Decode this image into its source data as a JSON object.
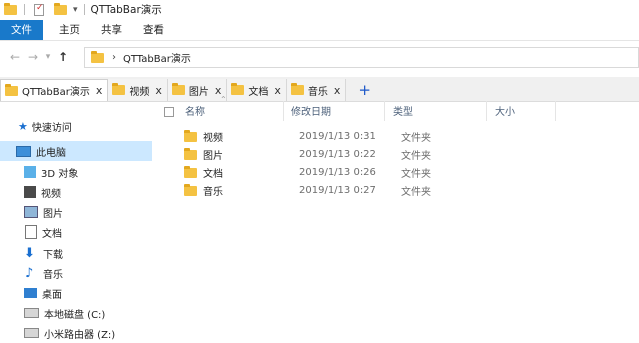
{
  "titlebar": {
    "title": "QTTabBar演示"
  },
  "ribbon": {
    "tabs": [
      "文件",
      "主页",
      "共享",
      "查看"
    ]
  },
  "address": {
    "chevron": "›",
    "path": "QTTabBar演示"
  },
  "folder_tabs": [
    {
      "label": "QTTabBar演示",
      "active": true
    },
    {
      "label": "视频",
      "active": false
    },
    {
      "label": "图片",
      "active": false
    },
    {
      "label": "文档",
      "active": false
    },
    {
      "label": "音乐",
      "active": false
    }
  ],
  "tab_close_glyph": "x",
  "new_tab_glyph": "+",
  "nav": {
    "quick_access": "快速访问",
    "items": [
      {
        "label": "此电脑",
        "icon": "computer-icon",
        "selected": true
      },
      {
        "label": "3D 对象",
        "icon": "3d-objects-icon"
      },
      {
        "label": "视频",
        "icon": "video-icon"
      },
      {
        "label": "图片",
        "icon": "pictures-icon"
      },
      {
        "label": "文档",
        "icon": "documents-icon"
      },
      {
        "label": "下载",
        "icon": "download-icon"
      },
      {
        "label": "音乐",
        "icon": "music-icon"
      },
      {
        "label": "桌面",
        "icon": "desktop-icon"
      },
      {
        "label": "本地磁盘 (C:)",
        "icon": "drive-icon"
      },
      {
        "label": "小米路由器 (Z:)",
        "icon": "network-drive-icon"
      }
    ]
  },
  "columns": {
    "name": "名称",
    "date": "修改日期",
    "type": "类型",
    "size": "大小"
  },
  "files": [
    {
      "name": "视频",
      "date": "2019/1/13 0:31",
      "type": "文件夹"
    },
    {
      "name": "图片",
      "date": "2019/1/13 0:22",
      "type": "文件夹"
    },
    {
      "name": "文档",
      "date": "2019/1/13 0:26",
      "type": "文件夹"
    },
    {
      "name": "音乐",
      "date": "2019/1/13 0:27",
      "type": "文件夹"
    }
  ],
  "colors": {
    "accent": "#1979ca",
    "selection": "#cce8ff",
    "folder": "#f4c242",
    "new_tab": "#1a56c8"
  }
}
